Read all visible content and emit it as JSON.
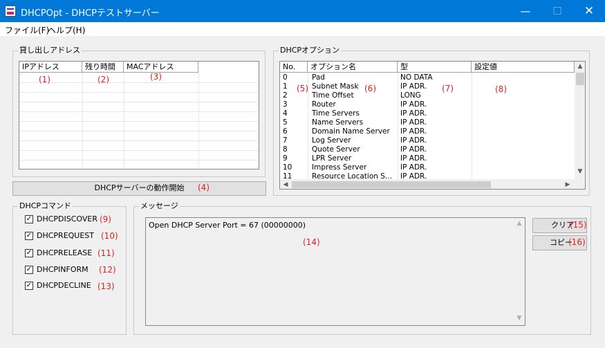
{
  "window": {
    "title": "DHCPOpt - DHCPテストサーバー",
    "minimize": "—",
    "maximize": "☐",
    "close": "✕"
  },
  "menu": {
    "file": "ファイル(F)",
    "help": "ヘルプ(H)"
  },
  "lease": {
    "group_label": "貸し出しアドレス",
    "columns": [
      "IPアドレス",
      "残り時間",
      "MACアドレス"
    ]
  },
  "options": {
    "group_label": "DHCPオプション",
    "columns": [
      "No.",
      "オプション名",
      "型",
      "設定値"
    ],
    "rows": [
      {
        "no": "0",
        "name": "Pad",
        "type": "NO DATA"
      },
      {
        "no": "1",
        "name": "Subnet Mask",
        "type": "IP ADR."
      },
      {
        "no": "2",
        "name": "Time Offset",
        "type": "LONG"
      },
      {
        "no": "3",
        "name": "Router",
        "type": "IP ADR."
      },
      {
        "no": "4",
        "name": "Time Servers",
        "type": "IP ADR."
      },
      {
        "no": "5",
        "name": "Name Servers",
        "type": "IP ADR."
      },
      {
        "no": "6",
        "name": "Domain Name Server",
        "type": "IP ADR."
      },
      {
        "no": "7",
        "name": "Log Server",
        "type": "IP ADR."
      },
      {
        "no": "8",
        "name": "Quote Server",
        "type": "IP ADR."
      },
      {
        "no": "9",
        "name": "LPR Server",
        "type": "IP ADR."
      },
      {
        "no": "10",
        "name": "Impress Server",
        "type": "IP ADR."
      },
      {
        "no": "11",
        "name": "Resource Location S...",
        "type": "IP ADR."
      }
    ]
  },
  "start_button": "DHCPサーバーの動作開始",
  "commands": {
    "group_label": "DHCPコマンド",
    "items": [
      {
        "label": "DHCPDISCOVER",
        "checked": true
      },
      {
        "label": "DHCPREQUEST",
        "checked": true
      },
      {
        "label": "DHCPRELEASE",
        "checked": true
      },
      {
        "label": "DHCPINFORM",
        "checked": true
      },
      {
        "label": "DHCPDECLINE",
        "checked": true
      }
    ],
    "check_mark": "✓"
  },
  "messages": {
    "group_label": "メッセージ",
    "text": "Open DHCP Server Port = 67 (00000000)"
  },
  "buttons": {
    "clear": "クリア",
    "copy": "コピー"
  },
  "annotations": [
    "(1)",
    "(2)",
    "(3)",
    "(4)",
    "(5)",
    "(6)",
    "(7)",
    "(8)",
    "(9)",
    "(10)",
    "(11)",
    "(12)",
    "(13)",
    "(14)",
    "(15)",
    "(16)"
  ],
  "scroll_arrows": {
    "up": "▲",
    "down": "▼",
    "left": "◀",
    "right": "▶"
  },
  "colors": {
    "titlebar": "#0078d7",
    "annotation": "#e02020",
    "window_bg": "#f0f0f0"
  }
}
